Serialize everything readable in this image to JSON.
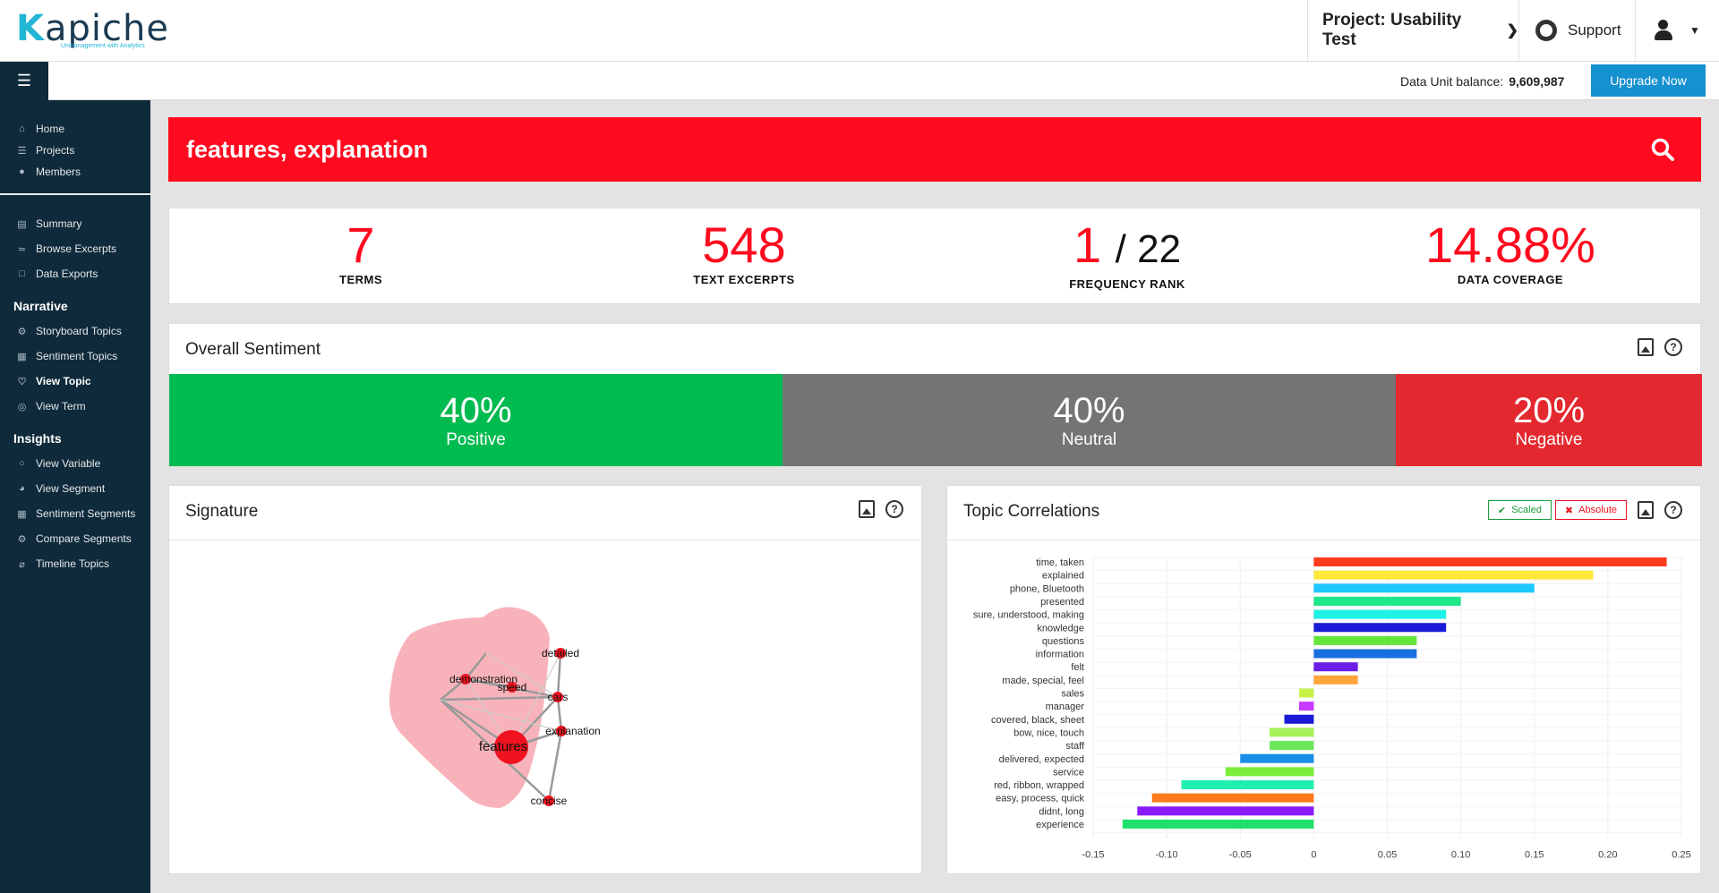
{
  "header": {
    "logo_text": "Kapiche",
    "logo_tagline": "Unmanagement with Analytics",
    "project_label": "Project: Usability Test",
    "support_label": "Support"
  },
  "subbar": {
    "balance_label": "Data Unit balance:",
    "balance_value": "9,609,987",
    "upgrade_label": "Upgrade Now"
  },
  "sidebar": {
    "top_items": [
      {
        "label": "Home",
        "icon": "home-icon"
      },
      {
        "label": "Projects",
        "icon": "projects-icon"
      },
      {
        "label": "Members",
        "icon": "user-icon"
      }
    ],
    "project_items": [
      {
        "label": "Summary",
        "icon": "summary-icon"
      },
      {
        "label": "Browse Excerpts",
        "icon": "browse-icon"
      },
      {
        "label": "Data Exports",
        "icon": "file-icon"
      }
    ],
    "narrative_heading": "Narrative",
    "narrative_items": [
      {
        "label": "Storyboard Topics",
        "icon": "storyboard-icon"
      },
      {
        "label": "Sentiment Topics",
        "icon": "sentiment-icon"
      },
      {
        "label": "View Topic",
        "icon": "heart-icon"
      },
      {
        "label": "View Term",
        "icon": "term-icon"
      }
    ],
    "insights_heading": "Insights",
    "insights_items": [
      {
        "label": "View Variable",
        "icon": "circle-icon"
      },
      {
        "label": "View Segment",
        "icon": "segment-icon"
      },
      {
        "label": "Sentiment Segments",
        "icon": "sentiment-segments-icon"
      },
      {
        "label": "Compare Segments",
        "icon": "compare-icon"
      },
      {
        "label": "Timeline Topics",
        "icon": "timeline-icon"
      }
    ]
  },
  "search": {
    "query": "features, explanation"
  },
  "stats": {
    "terms_value": "7",
    "terms_label": "TERMS",
    "excerpts_value": "548",
    "excerpts_label": "TEXT EXCERPTS",
    "rank_value": "1",
    "rank_total": "/ 22",
    "rank_label": "FREQUENCY RANK",
    "coverage_value": "14.88%",
    "coverage_label": "DATA COVERAGE"
  },
  "sentiment": {
    "title": "Overall Sentiment",
    "positive_pct": "40%",
    "positive_label": "Positive",
    "neutral_pct": "40%",
    "neutral_label": "Neutral",
    "negative_pct": "20%",
    "negative_label": "Negative",
    "colors": {
      "positive": "#00bb4f",
      "neutral": "#747474",
      "negative": "#e4282f"
    }
  },
  "signature": {
    "title": "Signature",
    "nodes": [
      {
        "label": "detailed"
      },
      {
        "label": "speed"
      },
      {
        "label": "demonstration"
      },
      {
        "label": "cars"
      },
      {
        "label": "explanation"
      },
      {
        "label": "features"
      },
      {
        "label": "concise"
      }
    ]
  },
  "correlations": {
    "title": "Topic Correlations",
    "scaled_label": "Scaled",
    "absolute_label": "Absolute"
  },
  "chart_data": {
    "type": "bar",
    "orientation": "horizontal",
    "title": "Topic Correlations",
    "categories": [
      "time, taken",
      "explained",
      "phone, Bluetooth",
      "presented",
      "sure, understood, making",
      "knowledge",
      "questions",
      "information",
      "felt",
      "made, special, feel",
      "sales",
      "manager",
      "covered, black, sheet",
      "bow, nice, touch",
      "staff",
      "delivered, expected",
      "service",
      "red, ribbon, wrapped",
      "easy, process, quick",
      "didnt, long",
      "experience"
    ],
    "values": [
      0.24,
      0.19,
      0.15,
      0.1,
      0.09,
      0.09,
      0.07,
      0.07,
      0.03,
      0.03,
      -0.01,
      -0.01,
      -0.02,
      -0.03,
      -0.03,
      -0.05,
      -0.06,
      -0.09,
      -0.11,
      -0.12,
      -0.13
    ],
    "colors": [
      "#ff3b1f",
      "#ffe83a",
      "#1ec8ff",
      "#1de88a",
      "#1ef2e6",
      "#1a1ad8",
      "#63e63a",
      "#1a6fe0",
      "#6a1ee8",
      "#ffa53a",
      "#c8f24a",
      "#c83aff",
      "#1a1ad8",
      "#a6f25a",
      "#6ae65a",
      "#1a8fe8",
      "#7aee3a",
      "#1ef0b0",
      "#ff7a1a",
      "#8a1aff",
      "#1ee06a"
    ],
    "xlim": [
      -0.15,
      0.25
    ],
    "xticks": [
      -0.15,
      -0.1,
      -0.05,
      0,
      0.05,
      0.1,
      0.15,
      0.2,
      0.25
    ],
    "xtick_labels": [
      "-0.15",
      "-0.10",
      "-0.05",
      "0",
      "0.05",
      "0.10",
      "0.15",
      "0.20",
      "0.25"
    ],
    "grid": true
  }
}
